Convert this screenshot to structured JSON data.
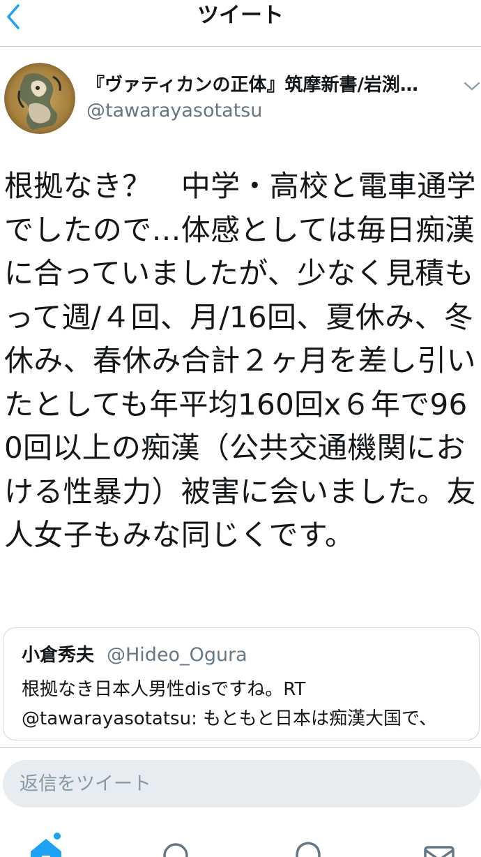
{
  "header": {
    "title": "ツイート",
    "back_icon": "chevron-left-icon"
  },
  "colors": {
    "accent": "#1da1f2",
    "text": "#14171a",
    "secondary_text": "#657786",
    "divider": "#c8ccd0",
    "reply_bg": "#e6ecf0"
  },
  "tweet": {
    "author_name": "『ヴァティカンの正体』筑摩新書/岩渕…",
    "author_handle": "@tawarayasotatsu",
    "avatar_icon": "avatar",
    "text": "根拠なき？　中学・高校と電車通学でしたので…体感としては毎日痴漢に合っていましたが、少なく見積もって週/４回、月/16回、夏休み、冬休み、春休み合計２ヶ月を差し引いたとしても年平均160回x６年で960回以上の痴漢（公共交通機関における性暴力）被害に会いました。友人女子もみな同じくです。"
  },
  "quoted_tweet": {
    "author_name": "小倉秀夫",
    "author_handle": "@Hideo_Ogura",
    "text": "根拠なき日本人男性disですね。RT\n@tawarayasotatsu: もともと日本は痴漢大国で、"
  },
  "reply": {
    "placeholder": "返信をツイート"
  },
  "tab_bar": {
    "items": [
      "home-icon",
      "search-icon",
      "notifications-icon",
      "messages-icon"
    ],
    "active": "home-icon"
  }
}
